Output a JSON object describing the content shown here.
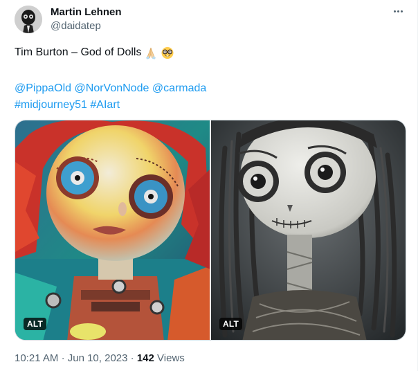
{
  "author": {
    "name": "Martin Lehnen",
    "handle": "@daidatep",
    "avatar_icon": "skull-avatar-icon"
  },
  "more_icon": "more-horizontal-icon",
  "tweet": {
    "text": "Tim Burton – God of Dolls",
    "emojis": [
      "folded-hands-icon",
      "nerd-face-icon"
    ],
    "mentions": [
      "@PippaOld",
      "@NorVonNode",
      "@carmada"
    ],
    "hashtags": [
      "#midjourney51",
      "#AIart"
    ]
  },
  "media": [
    {
      "alt_badge": "ALT",
      "description_icon": "colorful-doll-image"
    },
    {
      "alt_badge": "ALT",
      "description_icon": "pale-doll-image"
    }
  ],
  "footer": {
    "time": "10:21 AM",
    "separator": "·",
    "date": "Jun 10, 2023",
    "views_count": "142",
    "views_label": "Views"
  },
  "colors": {
    "link": "#1d9bf0",
    "text": "#0f1419",
    "secondary": "#536471"
  }
}
